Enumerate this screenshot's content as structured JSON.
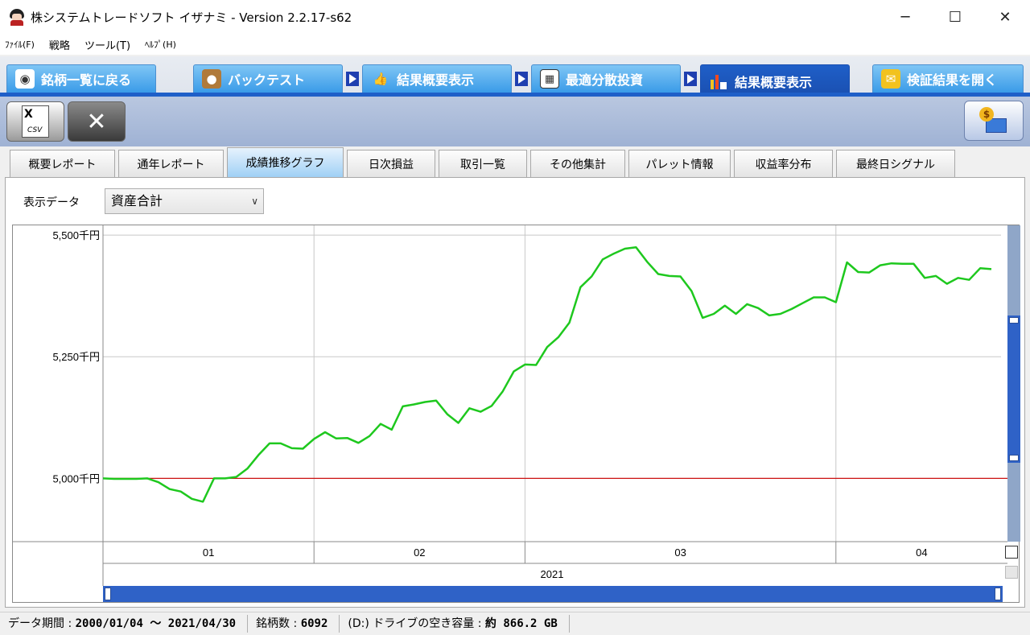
{
  "window": {
    "title": "株システムトレードソフト イザナミ - Version 2.2.17-s62",
    "minimize": "─",
    "maximize": "☐",
    "close": "✕"
  },
  "menu": [
    {
      "label": "ﾌｧｲﾙ(F)"
    },
    {
      "label": "戦略"
    },
    {
      "label": "ツール(T)"
    },
    {
      "label": "ﾍﾙﾌﾟ(H)"
    }
  ],
  "nav_tabs": [
    {
      "label": "銘柄一覧に戻る",
      "icon": "eye-icon"
    },
    {
      "label": "バックテスト",
      "icon": "bag-icon"
    },
    {
      "label": "結果概要表示",
      "icon": "thumbs-up-icon"
    },
    {
      "label": "最適分散投資",
      "icon": "calculator-icon"
    },
    {
      "label": "結果概要表示",
      "icon": "bar-chart-icon",
      "active": true
    },
    {
      "label": "検証結果を開く",
      "icon": "open-result-icon"
    }
  ],
  "toolbar": {
    "csv_label": "CSV",
    "csv_x": "X"
  },
  "sub_tabs": [
    {
      "label": "概要レポート"
    },
    {
      "label": "通年レポート"
    },
    {
      "label": "成績推移グラフ",
      "active": true
    },
    {
      "label": "日次損益"
    },
    {
      "label": "取引一覧"
    },
    {
      "label": "その他集計"
    },
    {
      "label": "パレット情報"
    },
    {
      "label": "収益率分布"
    },
    {
      "label": "最終日シグナル"
    }
  ],
  "display": {
    "label": "表示データ",
    "selected": "資産合計"
  },
  "chart_data": {
    "type": "line",
    "title": "",
    "ylabel": "",
    "xlabel": "",
    "y_unit": "千円",
    "ylim": [
      4870,
      5520
    ],
    "y_ticks": [
      "5,500千円",
      "5,250千円",
      "5,000千円"
    ],
    "y_tick_values": [
      5500,
      5250,
      5000
    ],
    "x_months": [
      "01",
      "02",
      "03",
      "04"
    ],
    "x_year": "2021",
    "baseline": 5000,
    "colors": {
      "line": "#1ec81e",
      "baseline": "#cc1111",
      "grid": "#c8c8c8"
    },
    "series": [
      {
        "values": [
          5000,
          4999,
          4999,
          4999,
          5000,
          4992,
          4978,
          4973,
          4958,
          4952,
          5000,
          5000,
          5003,
          5020,
          5048,
          5072,
          5072,
          5062,
          5061,
          5081,
          5095,
          5082,
          5083,
          5073,
          5087,
          5112,
          5100,
          5148,
          5152,
          5157,
          5160,
          5132,
          5114,
          5144,
          5137,
          5149,
          5179,
          5220,
          5234,
          5233,
          5270,
          5290,
          5320,
          5393,
          5415,
          5450,
          5462,
          5472,
          5475,
          5445,
          5420,
          5416,
          5415,
          5385,
          5330,
          5338,
          5355,
          5338,
          5358,
          5350,
          5335,
          5338,
          5348,
          5360,
          5372,
          5372,
          5362,
          5444,
          5424,
          5423,
          5438,
          5442,
          5441,
          5441,
          5412,
          5416,
          5400,
          5412,
          5408,
          5432,
          5430
        ]
      }
    ]
  },
  "status": {
    "period_label": "データ期間 : ",
    "period_value": "2000/01/04 ～ 2021/04/30",
    "count_label": "銘柄数 : ",
    "count_value": "6092",
    "disk_label": "(D:) ドライブの空き容量 : ",
    "disk_value": "約 866.2 GB"
  }
}
